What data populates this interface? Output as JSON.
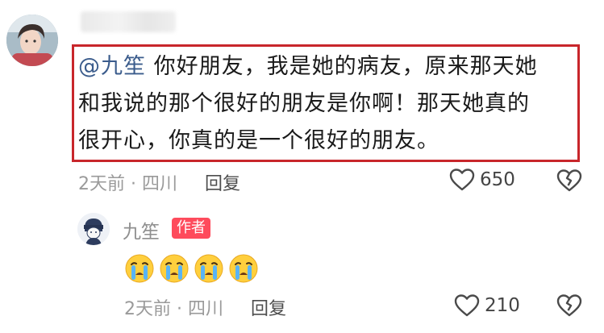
{
  "comment": {
    "mention": "@九笙",
    "text_lines": [
      "你好朋友，我是她的病友，原来那天她",
      "和我说的那个很好的朋友是你啊！那天她真的",
      "很开心，你真的是一个很好的朋友。"
    ],
    "meta": "2天前 · 四川",
    "reply_label": "回复",
    "like_count": "650",
    "highlight_color": "#c8262b"
  },
  "reply": {
    "username": "九笙",
    "badge": "作者",
    "emojis": [
      "crying-emoji",
      "crying-emoji",
      "crying-emoji",
      "crying-emoji"
    ],
    "meta": "2天前 · 四川",
    "reply_label": "回复",
    "like_count": "210",
    "badge_color": "#fe4b5c"
  }
}
